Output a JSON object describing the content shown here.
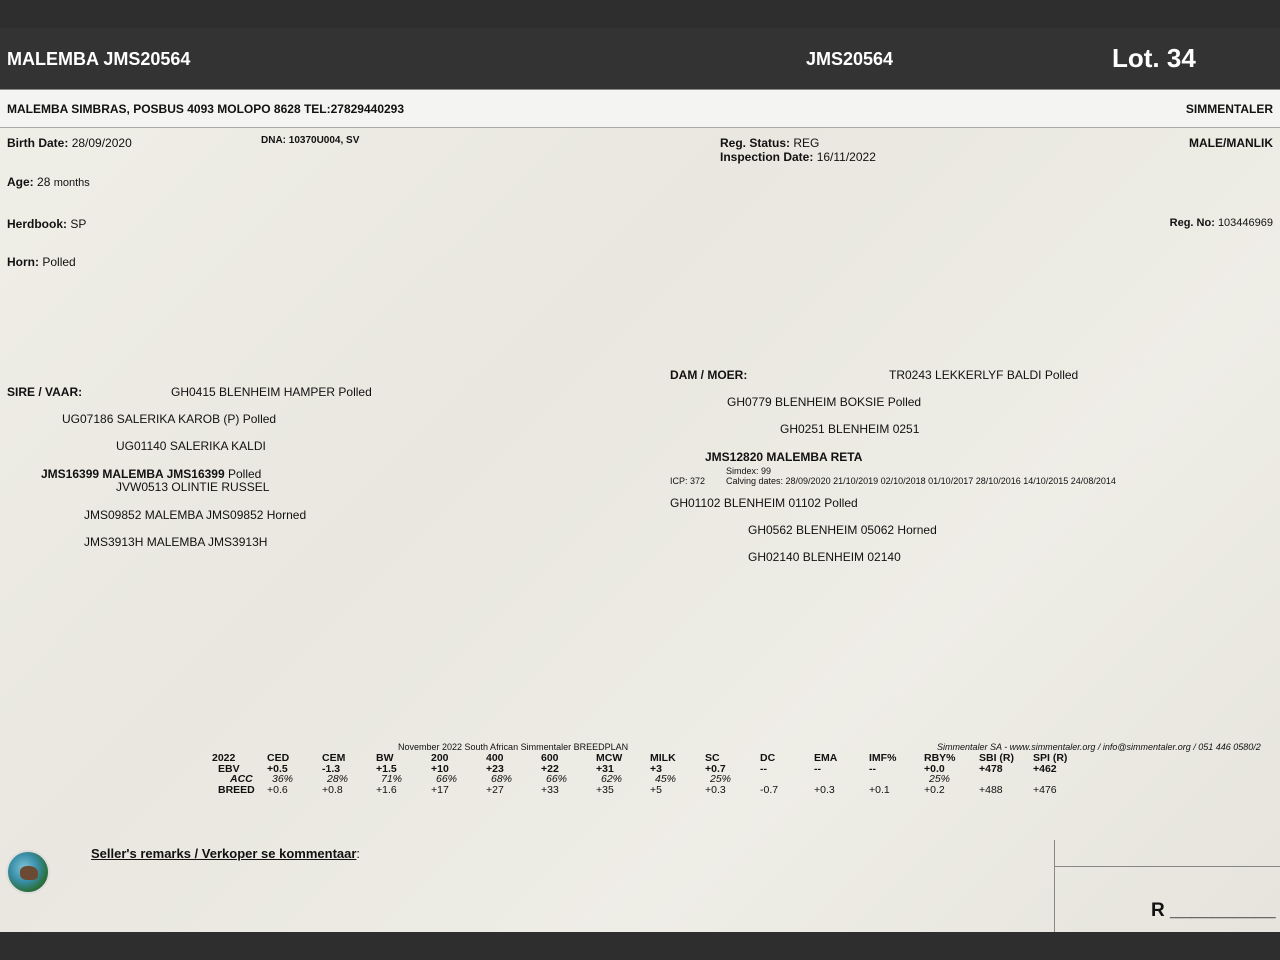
{
  "header": {
    "title": "MALEMBA JMS20564",
    "reg_id": "JMS20564",
    "lot": "Lot. 34"
  },
  "owner": {
    "address": "MALEMBA SIMBRAS, POSBUS 4093 MOLOPO 8628 TEL:27829440293",
    "breed": "SIMMENTALER"
  },
  "details": {
    "birth_label": "Birth Date:",
    "birth_value": "28/09/2020",
    "dna": "DNA: 10370U004, SV",
    "reg_status_label": "Reg. Status:",
    "reg_status_value": "REG",
    "inspection_label": "Inspection Date:",
    "inspection_value": "16/11/2022",
    "sex": "MALE/MANLIK",
    "age_label": "Age:",
    "age_value": "28",
    "age_unit": "months",
    "herdbook_label": "Herdbook:",
    "herdbook_value": "SP",
    "regno_label": "Reg. No:",
    "regno_value": "103446969",
    "horn_label": "Horn:",
    "horn_value": "Polled"
  },
  "pedigree": {
    "sire_label": "SIRE / VAAR:",
    "sire": "GH0415 BLENHEIM HAMPER  Polled",
    "sire_sire": "UG07186 SALERIKA KAROB (P)  Polled",
    "sire_sire_sire": "UG01140 SALERIKA KALDI",
    "sire_dam_name": "JMS16399 MALEMBA JMS16399",
    "sire_dam_horn": "Polled",
    "sire_sire_dam": "JVW0513 OLINTIE RUSSEL",
    "sire_dam_sire": "JMS09852 MALEMBA JMS09852  Horned",
    "sire_dam_dam": "JMS3913H MALEMBA JMS3913H",
    "dam_label": "DAM / MOER:",
    "dam_sire": "TR0243 LEKKERLYF BALDI  Polled",
    "dam_sire_sire": "GH0779 BLENHEIM BOKSIE  Polled",
    "dam_sire_dam": "GH0251 BLENHEIM 0251",
    "dam": "JMS12820 MALEMBA RETA",
    "simdex": "Simdex: 99",
    "icp": "ICP: 372",
    "calving": "Calving dates: 28/09/2020  21/10/2019  02/10/2018  01/10/2017  28/10/2016  14/10/2015  24/08/2014",
    "dam_dam": "GH01102 BLENHEIM 01102  Polled",
    "dam_dam_sire": "GH0562 BLENHEIM 05062  Horned",
    "dam_dam_dam": "GH02140 BLENHEIM 02140"
  },
  "breedplan": {
    "caption": "November 2022 South African Simmentaler BREEDPLAN",
    "source": "Simmentaler SA - www.simmentaler.org / info@simmentaler.org / 051 446 0580/2",
    "columns": [
      "2022",
      "CED",
      "CEM",
      "BW",
      "200",
      "400",
      "600",
      "MCW",
      "MILK",
      "SC",
      "DC",
      "EMA",
      "IMF%",
      "RBY%",
      "SBI (R)",
      "SPI (R)"
    ],
    "rows": [
      {
        "label": "EBV",
        "cells": [
          "+0.5",
          "-1.3",
          "+1.5",
          "+10",
          "+23",
          "+22",
          "+31",
          "+3",
          "+0.7",
          "--",
          "--",
          "--",
          "+0.0",
          "+478",
          "+462"
        ]
      },
      {
        "label": "ACC",
        "cells": [
          "36%",
          "28%",
          "71%",
          "66%",
          "68%",
          "66%",
          "62%",
          "45%",
          "25%",
          "",
          "",
          "",
          "25%",
          "",
          ""
        ]
      },
      {
        "label": "BREED",
        "cells": [
          "+0.6",
          "+0.8",
          "+1.6",
          "+17",
          "+27",
          "+33",
          "+35",
          "+5",
          "+0.3",
          "-0.7",
          "+0.3",
          "+0.1",
          "+0.2",
          "+488",
          "+476"
        ]
      }
    ]
  },
  "footer": {
    "remarks": "Seller's remarks / Verkoper se kommentaar",
    "remarks_colon": ":",
    "price": "R __________",
    "logo_icon": "globe-cattle-logo-icon"
  }
}
